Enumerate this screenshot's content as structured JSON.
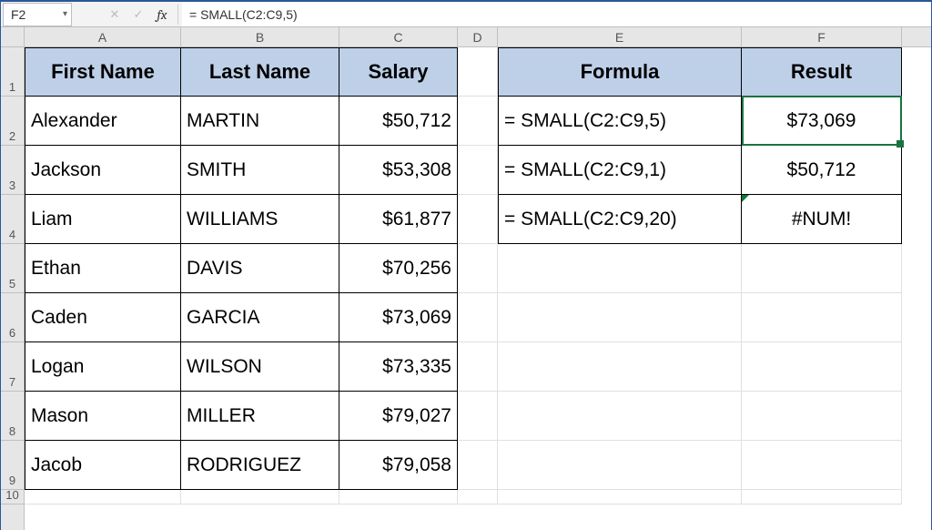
{
  "namebox": {
    "value": "F2",
    "dropdown": "▾"
  },
  "formula_bar": {
    "fx_label": "fx",
    "formula": "= SMALL(C2:C9,5)"
  },
  "col_headers": [
    "A",
    "B",
    "C",
    "D",
    "E",
    "F"
  ],
  "row_headers": [
    "1",
    "2",
    "3",
    "4",
    "5",
    "6",
    "7",
    "8",
    "9",
    "10"
  ],
  "headers_left": {
    "first": "First Name",
    "last": "Last Name",
    "salary": "Salary"
  },
  "headers_right": {
    "formula": "Formula",
    "result": "Result"
  },
  "people": [
    {
      "first": "Alexander",
      "last": "MARTIN",
      "salary": "$50,712"
    },
    {
      "first": "Jackson",
      "last": "SMITH",
      "salary": "$53,308"
    },
    {
      "first": "Liam",
      "last": "WILLIAMS",
      "salary": "$61,877"
    },
    {
      "first": "Ethan",
      "last": "DAVIS",
      "salary": "$70,256"
    },
    {
      "first": "Caden",
      "last": "GARCIA",
      "salary": "$73,069"
    },
    {
      "first": "Logan",
      "last": "WILSON",
      "salary": "$73,335"
    },
    {
      "first": "Mason",
      "last": "MILLER",
      "salary": "$79,027"
    },
    {
      "first": "Jacob",
      "last": "RODRIGUEZ",
      "salary": "$79,058"
    }
  ],
  "formulas": [
    {
      "formula": "= SMALL(C2:C9,5)",
      "result": "$73,069"
    },
    {
      "formula": "= SMALL(C2:C9,1)",
      "result": "$50,712"
    },
    {
      "formula": "= SMALL(C2:C9,20)",
      "result": "#NUM!"
    }
  ]
}
